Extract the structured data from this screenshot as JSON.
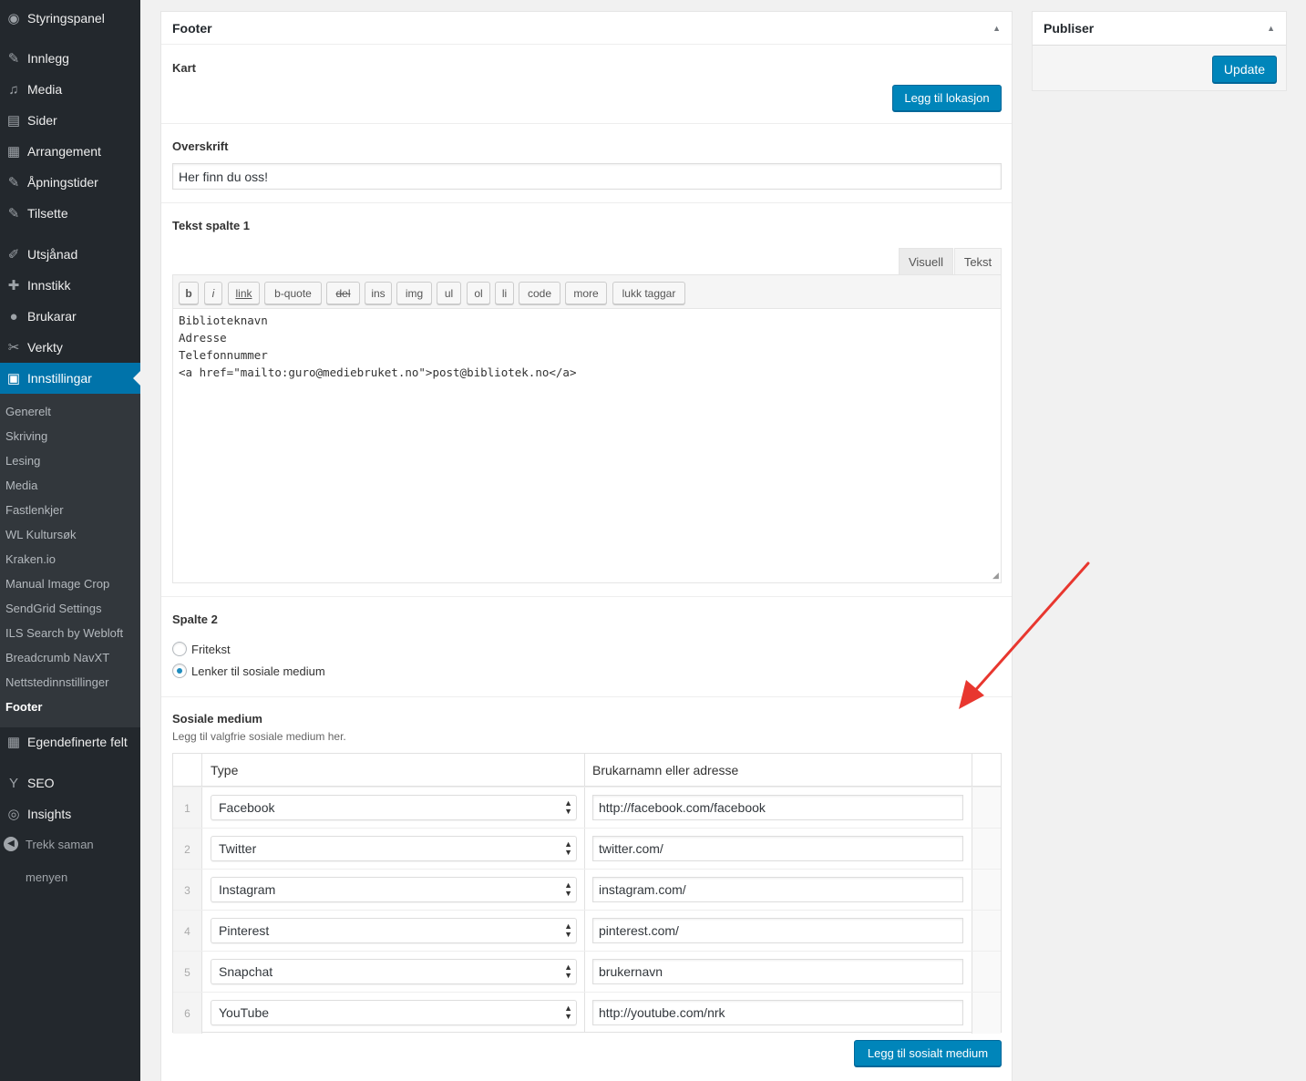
{
  "sidebar": {
    "top_items": [
      {
        "icon": "dashboard-icon",
        "glyph": "◉",
        "label": "Styringspanel"
      },
      {
        "icon": "pin-icon",
        "glyph": "✎",
        "label": "Innlegg"
      },
      {
        "icon": "media-icon",
        "glyph": "♫",
        "label": "Media"
      },
      {
        "icon": "pages-icon",
        "glyph": "▤",
        "label": "Sider"
      },
      {
        "icon": "calendar-icon",
        "glyph": "▦",
        "label": "Arrangement"
      },
      {
        "icon": "pin-icon",
        "glyph": "✎",
        "label": "Åpningstider"
      },
      {
        "icon": "pin-icon",
        "glyph": "✎",
        "label": "Tilsette"
      },
      {
        "icon": "appearance-icon",
        "glyph": "✐",
        "label": "Utsjånad"
      },
      {
        "icon": "plugin-icon",
        "glyph": "✚",
        "label": "Innstikk"
      },
      {
        "icon": "user-icon",
        "glyph": "●",
        "label": "Brukarar"
      },
      {
        "icon": "wrench-icon",
        "glyph": "✂",
        "label": "Verkty"
      },
      {
        "icon": "settings-icon",
        "glyph": "▣",
        "label": "Innstillingar"
      }
    ],
    "sub_items": [
      "Generelt",
      "Skriving",
      "Lesing",
      "Media",
      "Fastlenkjer",
      "WL Kultursøk",
      "Kraken.io",
      "Manual Image Crop",
      "SendGrid Settings",
      "ILS Search by Webloft",
      "Breadcrumb NavXT",
      "Nettstedinnstillinger",
      "Footer"
    ],
    "bottom_items": [
      {
        "icon": "custom-fields-icon",
        "glyph": "▦",
        "label": "Egendefinerte felt"
      },
      {
        "icon": "seo-icon",
        "glyph": "Y",
        "label": "SEO"
      },
      {
        "icon": "insights-icon",
        "glyph": "◎",
        "label": "Insights"
      }
    ],
    "collapse_label_1": "Trekk saman",
    "collapse_label_2": "menyen"
  },
  "main_box": {
    "title": "Footer",
    "kart_label": "Kart",
    "add_location_button": "Legg til lokasjon",
    "heading_label": "Overskrift",
    "heading_value": "Her finn du oss!",
    "text_col1_label": "Tekst spalte 1",
    "tab_visual": "Visuell",
    "tab_text": "Tekst",
    "quicktags": [
      "b",
      "i",
      "link",
      "b-quote",
      "del",
      "ins",
      "img",
      "ul",
      "ol",
      "li",
      "code",
      "more",
      "lukk taggar"
    ],
    "editor_content": "Biblioteknavn\nAdresse\nTelefonnummer\n<a href=\"mailto:guro@mediebruket.no\">post@bibliotek.no</a>",
    "col2_label": "Spalte 2",
    "col2_options": [
      {
        "label": "Fritekst",
        "checked": false
      },
      {
        "label": "Lenker til sosiale medium",
        "checked": true
      }
    ],
    "social_label": "Sosiale medium",
    "social_description": "Legg til valgfrie sosiale medium her.",
    "table_headers": {
      "type": "Type",
      "address": "Brukarnamn eller adresse"
    },
    "rows": [
      {
        "num": "1",
        "type": "Facebook",
        "address": "http://facebook.com/facebook"
      },
      {
        "num": "2",
        "type": "Twitter",
        "address": "twitter.com/"
      },
      {
        "num": "3",
        "type": "Instagram",
        "address": "instagram.com/"
      },
      {
        "num": "4",
        "type": "Pinterest",
        "address": "pinterest.com/"
      },
      {
        "num": "5",
        "type": "Snapchat",
        "address": "brukernavn"
      },
      {
        "num": "6",
        "type": "YouTube",
        "address": "http://youtube.com/nrk"
      }
    ],
    "add_social_button": "Legg til sosialt medium"
  },
  "publish_box": {
    "title": "Publiser",
    "update_button": "Update"
  },
  "colors": {
    "sidebar_bg": "#23282d",
    "submenu_bg": "#32373c",
    "accent": "#0073aa",
    "button": "#0085ba",
    "annotation_arrow": "#e8372f"
  }
}
